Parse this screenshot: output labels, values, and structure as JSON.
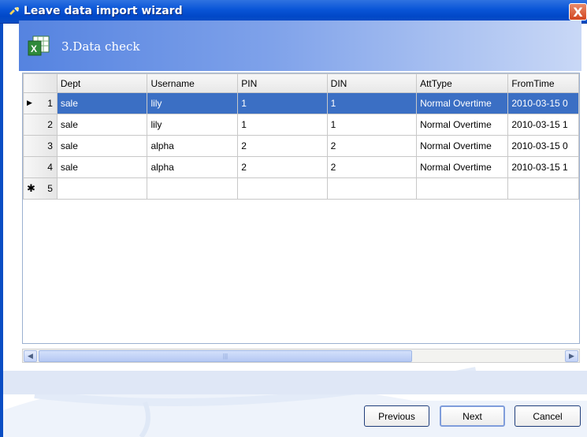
{
  "window": {
    "title": "Leave data import wizard",
    "close_label": "X"
  },
  "step": {
    "title": "3.Data check"
  },
  "grid": {
    "columns": [
      "Dept",
      "Username",
      "PIN",
      "DIN",
      "AttType",
      "FromTime"
    ],
    "rows": [
      {
        "num": "1",
        "cells": [
          "sale",
          "lily",
          "1",
          "1",
          "Normal Overtime",
          "2010-03-15 0"
        ]
      },
      {
        "num": "2",
        "cells": [
          "sale",
          "lily",
          "1",
          "1",
          "Normal Overtime",
          "2010-03-15 1"
        ]
      },
      {
        "num": "3",
        "cells": [
          "sale",
          "alpha",
          "2",
          "2",
          "Normal Overtime",
          "2010-03-15 0"
        ]
      },
      {
        "num": "4",
        "cells": [
          "sale",
          "alpha",
          "2",
          "2",
          "Normal Overtime",
          "2010-03-15 1"
        ]
      }
    ],
    "new_row_num": "5",
    "selected_row_marker": "▶",
    "new_row_marker": "✱"
  },
  "scrollbar": {
    "left_arrow": "◀",
    "right_arrow": "▶",
    "grip": "|||"
  },
  "buttons": {
    "previous": "Previous",
    "next": "Next",
    "cancel": "Cancel"
  },
  "colors": {
    "titlebar": "#0a56d8",
    "selection": "#3b6fc4",
    "header_gradient_start": "#5583e0"
  }
}
